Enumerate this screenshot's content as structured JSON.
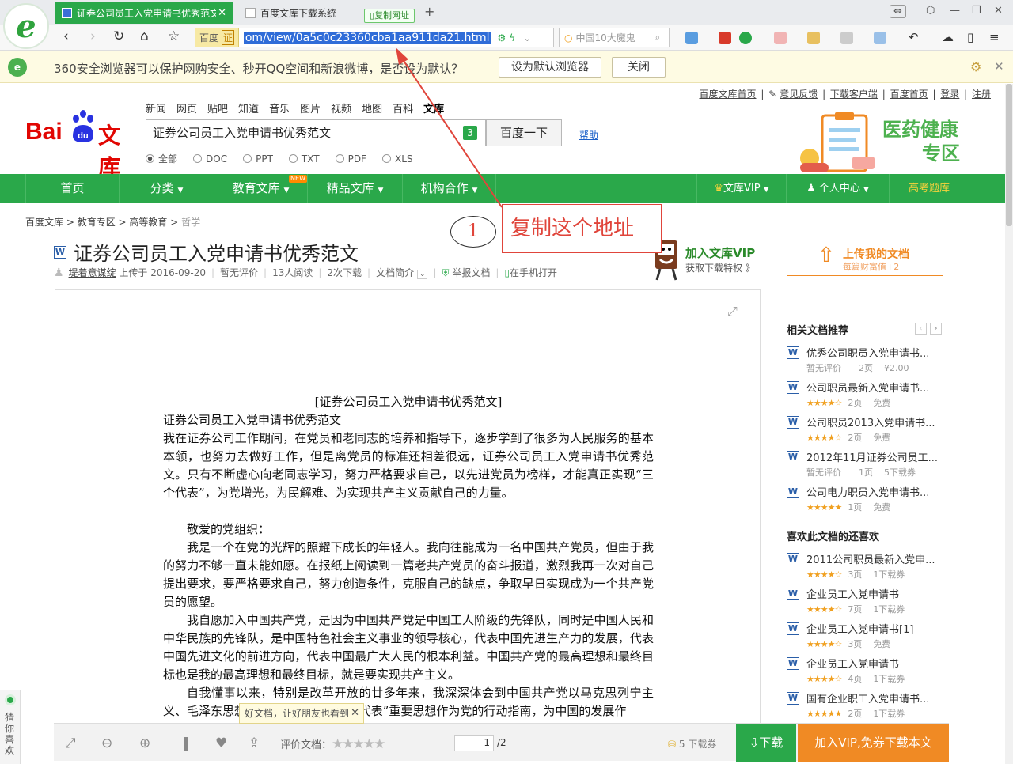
{
  "browser": {
    "tabs": [
      {
        "label": "证券公司员工入党申请书优秀范文"
      },
      {
        "label": "百度文库下载系统"
      }
    ],
    "copy_url_chip": "复制网址",
    "secure_label": "百度",
    "secure_badge": "证",
    "url": "om/view/0a5c0c23360cba1aa911da21.html",
    "search_placeholder": "中国10大魔鬼",
    "colors": {
      "accent": "#2aa84a",
      "tab_active": "#2aa84a",
      "url_highlight": "#2f6cd8"
    }
  },
  "notification": {
    "message": "360安全浏览器可以保护网购安全、秒开QQ空间和新浪微博，是否设为默认？",
    "set_default": "设为默认浏览器",
    "close": "关闭"
  },
  "top_links": [
    "百度文库首页",
    "意见反馈",
    "下载客户端",
    "百度首页",
    "登录",
    "注册"
  ],
  "header": {
    "logo_bai": "Bai",
    "logo_du": "du",
    "logo_wenku": "文库",
    "nav": [
      "新闻",
      "网页",
      "贴吧",
      "知道",
      "音乐",
      "图片",
      "视频",
      "地图",
      "百科",
      "文库"
    ],
    "search_value": "证券公司员工入党申请书优秀范文",
    "search_badge": "3",
    "search_button": "百度一下",
    "help": "帮助",
    "filters": [
      "全部",
      "DOC",
      "PPT",
      "TXT",
      "PDF",
      "XLS"
    ],
    "ad_line1": "医药健康",
    "ad_line2": "专区"
  },
  "main_nav": {
    "items": [
      "首页",
      "分类",
      "教育文库",
      "精品文库",
      "机构合作"
    ],
    "new_badge": "NEW",
    "vip": "文库VIP",
    "personal": "个人中心",
    "gaokao": "高考题库"
  },
  "breadcrumb": [
    "百度文库",
    "教育专区",
    "高等教育",
    "哲学"
  ],
  "document": {
    "title": "证券公司员工入党申请书优秀范文",
    "author": "堤着意谋绽",
    "uploaded": "上传于 2016-09-20",
    "rating": "暂无评价",
    "reads": "13人阅读",
    "downloads": "2次下载",
    "intro": "文档简介",
    "report": "举报文档",
    "mobile": "在手机打开",
    "body": [
      "[证券公司员工入党申请书优秀范文]",
      "证券公司员工入党申请书优秀范文",
      "我在证券公司工作期间，在党员和老同志的培养和指导下，逐步学到了很多为人民服务的基本本领，也努力去做好工作，但是离党员的标准还相差很远，证券公司员工入党申请书优秀范文。只有不断虚心向老同志学习，努力严格要求自己，以先进党员为榜样，才能真正实现“三个代表”，为党增光，为民解难、为实现共产主义贡献自己的力量。",
      "敬爱的党组织：",
      "我是一个在党的光辉的照耀下成长的年轻人。我向往能成为一名中国共产党员，但由于我的努力不够一直未能如愿。在报纸上阅读到一篇老共产党员的奋斗报道，激烈我再一次对自己提出要求，要严格要求自己，努力创造条件，克服自己的缺点，争取早日实现成为一个共产党员的愿望。",
      "我自愿加入中国共产党，是因为中国共产党是中国工人阶级的先锋队，同时是中国人民和中华民族的先锋队，是中国特色社会主义事业的领导核心，代表中国先进生产力的发展，代表中国先进文化的前进方向，代表中国最广大人民的根本利益。中国共产党的最高理想和最终目标也是我的最高理想和最终目标，就是要实现共产主义。",
      "自我懂事以来，特别是改革开放的廿多年来，我深深体会到中国共产党以马克思列宁主义、毛泽东思想、邓小平理论和“三个代表”重要思想作为党的行动指南，为中国的发展作"
    ]
  },
  "vip_promo": {
    "title": "加入文库VIP",
    "sub": "获取下载特权 》"
  },
  "upload": {
    "title": "上传我的文档",
    "sub": "每篇财富值+2"
  },
  "annotation": {
    "number": "1",
    "text": "复制这个地址"
  },
  "related": {
    "heading": "相关文档推荐",
    "items": [
      {
        "title": "优秀公司职员入党申请书...",
        "meta1": "暂无评价",
        "meta2": "2页",
        "meta3": "¥2.00",
        "stars": 0
      },
      {
        "title": "公司职员最新入党申请书...",
        "meta1": "",
        "meta2": "2页",
        "meta3": "免费",
        "stars": 4
      },
      {
        "title": "公司职员2013入党申请书...",
        "meta1": "",
        "meta2": "2页",
        "meta3": "免费",
        "stars": 4
      },
      {
        "title": "2012年11月证券公司员工...",
        "meta1": "暂无评价",
        "meta2": "1页",
        "meta3": "5下载券",
        "stars": 0
      },
      {
        "title": "公司电力职员入党申请书...",
        "meta1": "",
        "meta2": "1页",
        "meta3": "免费",
        "stars": 5
      }
    ]
  },
  "also_like": {
    "heading": "喜欢此文档的还喜欢",
    "items": [
      {
        "title": "2011公司职员最新入党申...",
        "meta2": "3页",
        "meta3": "1下载券",
        "stars": 4
      },
      {
        "title": "企业员工入党申请书",
        "meta2": "7页",
        "meta3": "1下载券",
        "stars": 4
      },
      {
        "title": "企业员工入党申请书[1]",
        "meta2": "3页",
        "meta3": "免费",
        "stars": 4
      },
      {
        "title": "企业员工入党申请书",
        "meta2": "4页",
        "meta3": "1下载券",
        "stars": 4
      },
      {
        "title": "国有企业职工入党申请书...",
        "meta2": "2页",
        "meta3": "1下载券",
        "stars": 4.5
      }
    ]
  },
  "toolbar": {
    "rate_label": "评价文档：",
    "page_current": "1",
    "page_total": "/2",
    "download_count": "5 下载券",
    "download": "下载",
    "vip_download": "加入VIP,免券下载本文",
    "share_tip": "好文档，让好朋友也看到"
  },
  "guess": "猜你喜欢"
}
